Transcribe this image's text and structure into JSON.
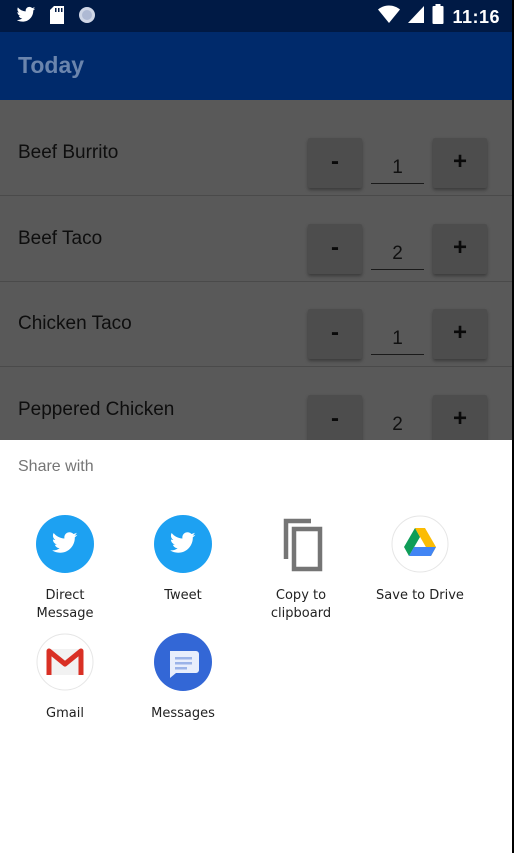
{
  "status_bar": {
    "time": "11:16",
    "left_icons": [
      "twitter-icon",
      "sd-card-icon",
      "circle-icon"
    ],
    "right_icons": [
      "wifi-icon",
      "cell-signal-icon",
      "battery-icon"
    ]
  },
  "app_bar": {
    "title": "Today"
  },
  "items": [
    {
      "name": "Beef Burrito",
      "minus": "-",
      "qty": "1",
      "plus": "+"
    },
    {
      "name": "Beef Taco",
      "minus": "-",
      "qty": "2",
      "plus": "+"
    },
    {
      "name": "Chicken Taco",
      "minus": "-",
      "qty": "1",
      "plus": "+"
    },
    {
      "name": "Peppered Chicken",
      "minus": "-",
      "qty": "2",
      "plus": "+"
    }
  ],
  "share_sheet": {
    "title": "Share with",
    "targets": [
      {
        "label": "Direct\nMessage",
        "icon": "twitter-icon",
        "color": "#1da1f2"
      },
      {
        "label": "Tweet",
        "icon": "twitter-icon",
        "color": "#1da1f2"
      },
      {
        "label": "Copy to\nclipboard",
        "icon": "copy-icon",
        "color": "#757575"
      },
      {
        "label": "Save to Drive",
        "icon": "google-drive-icon",
        "color": "#ffffff"
      },
      {
        "label": "Gmail",
        "icon": "gmail-icon",
        "color": "#ffffff"
      },
      {
        "label": "Messages",
        "icon": "messages-icon",
        "color": "#3367d6"
      }
    ]
  }
}
